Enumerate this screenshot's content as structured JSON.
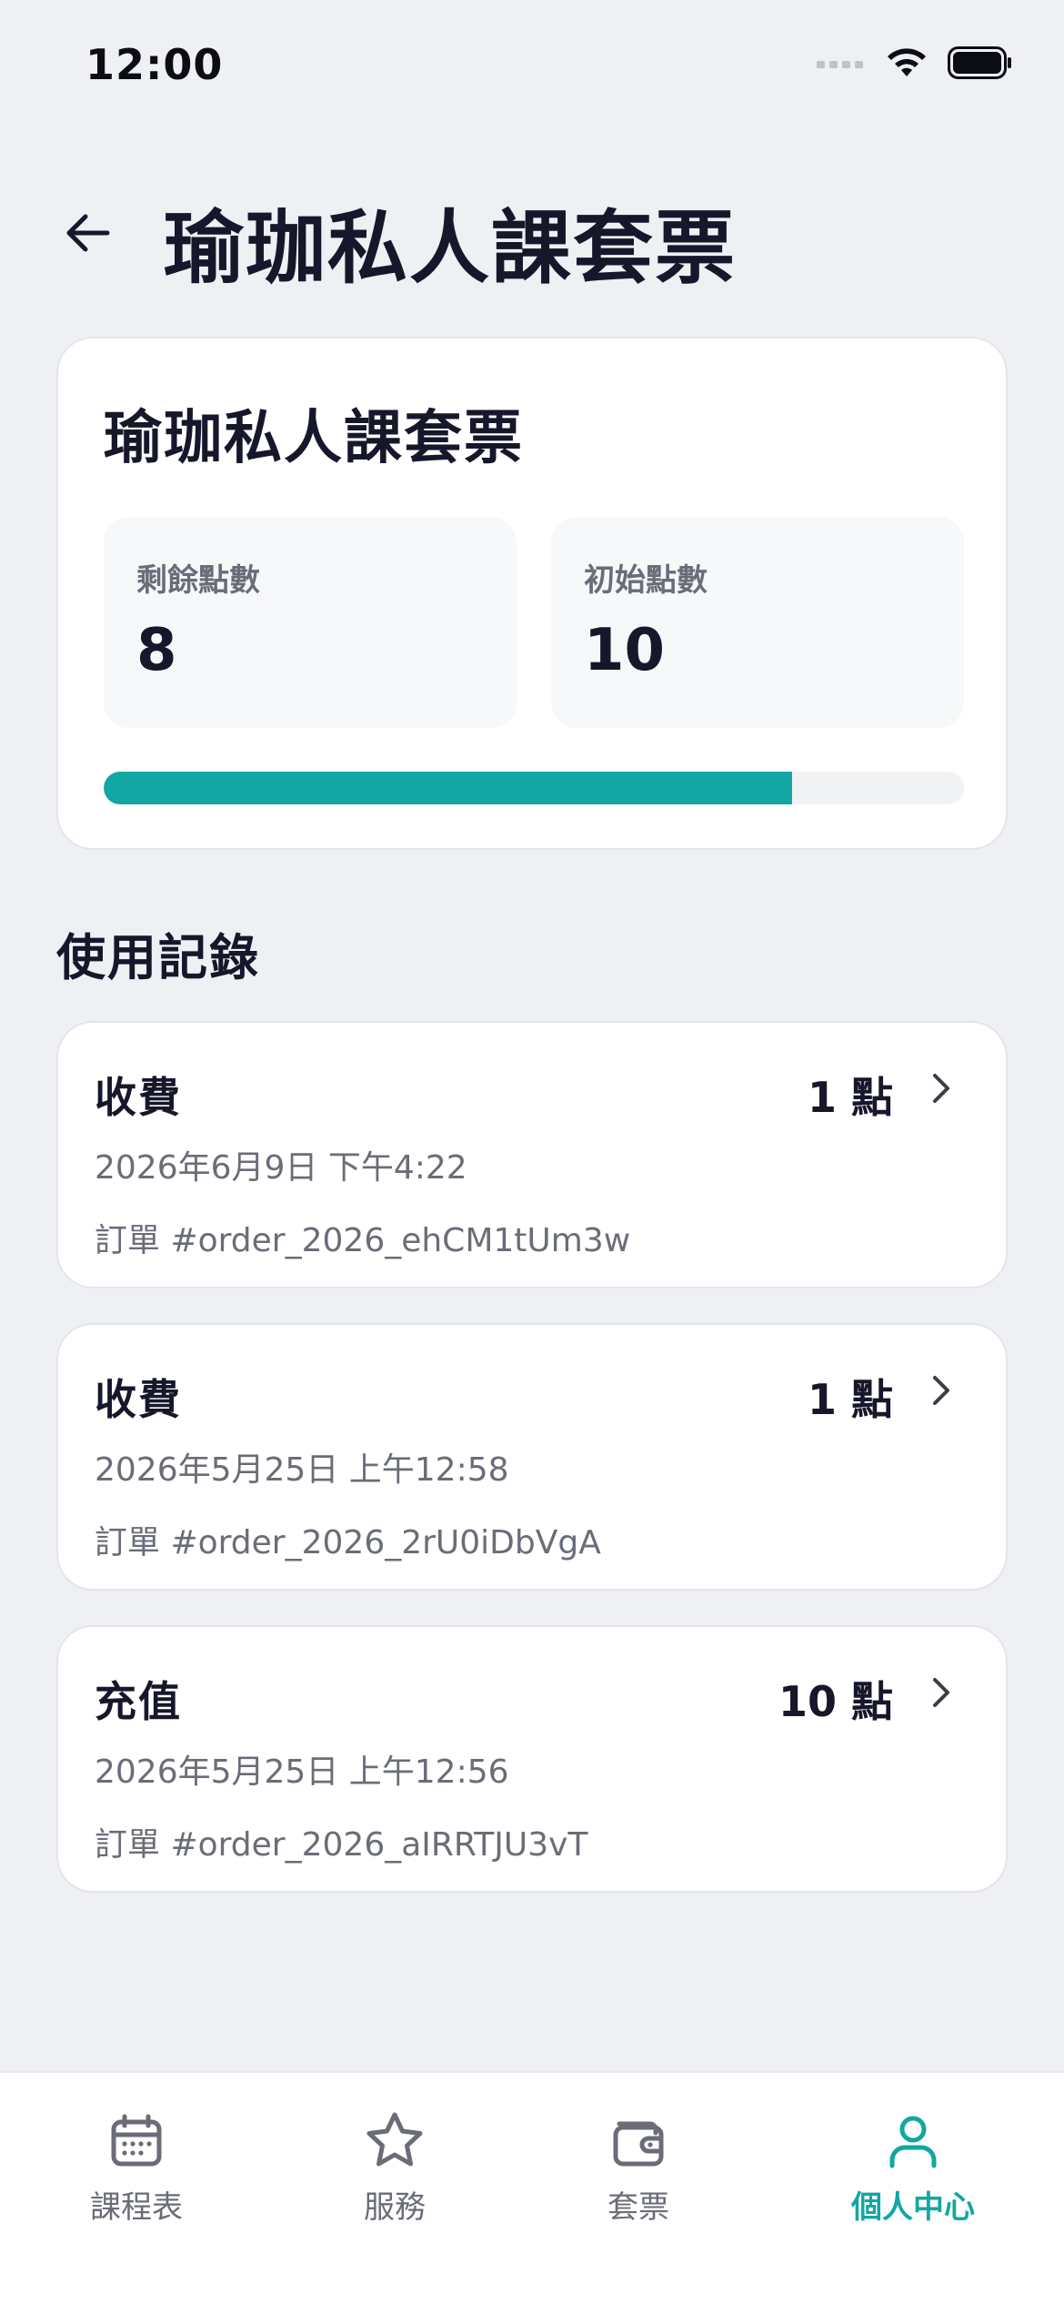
{
  "status_bar": {
    "time": "12:00"
  },
  "header": {
    "title": "瑜珈私人課套票"
  },
  "summary": {
    "title": "瑜珈私人課套票",
    "remaining_label": "剩餘點數",
    "remaining_value": "8",
    "initial_label": "初始點數",
    "initial_value": "10",
    "progress_fraction": 0.8
  },
  "records_section": {
    "title": "使用記錄"
  },
  "records": [
    {
      "type": "收費",
      "points": "1 點",
      "date": "2026年6月9日 下午4:22",
      "order": "訂單 #order_2026_ehCM1tUm3w"
    },
    {
      "type": "收費",
      "points": "1 點",
      "date": "2026年5月25日 上午12:58",
      "order": "訂單 #order_2026_2rU0iDbVgA"
    },
    {
      "type": "充值",
      "points": "10 點",
      "date": "2026年5月25日 上午12:56",
      "order": "訂單 #order_2026_aIRRTJU3vT"
    }
  ],
  "tabs": [
    {
      "label": "課程表",
      "icon": "calendar-icon",
      "active": false
    },
    {
      "label": "服務",
      "icon": "star-icon",
      "active": false
    },
    {
      "label": "套票",
      "icon": "wallet-icon",
      "active": false
    },
    {
      "label": "個人中心",
      "icon": "person-icon",
      "active": true
    }
  ],
  "colors": {
    "accent": "#12A7A2",
    "background": "#EEF0F3",
    "text_primary": "#17172B",
    "text_secondary": "#6A6D78"
  }
}
